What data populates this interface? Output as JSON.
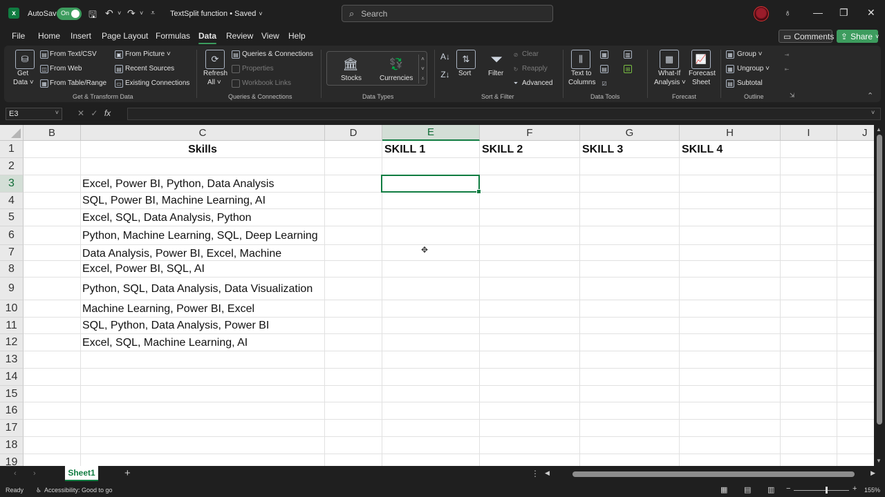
{
  "titlebar": {
    "autosave_label": "AutoSave",
    "autosave_state": "On",
    "file_title": "TextSplit function • Saved",
    "search_placeholder": "Search"
  },
  "menu": {
    "tabs": [
      "File",
      "Home",
      "Insert",
      "Page Layout",
      "Formulas",
      "Data",
      "Review",
      "View",
      "Help"
    ],
    "active": "Data",
    "comments_label": "Comments",
    "share_label": "Share"
  },
  "ribbon": {
    "get_transform": {
      "get_data": [
        "Get",
        "Data ˅"
      ],
      "from_text_csv": "From Text/CSV",
      "from_web": "From Web",
      "from_table_range": "From Table/Range",
      "from_picture": "From Picture ˅",
      "recent_sources": "Recent Sources",
      "existing_connections": "Existing Connections",
      "group_label": "Get & Transform Data"
    },
    "queries": {
      "refresh_all": [
        "Refresh",
        "All ˅"
      ],
      "queries_connections": "Queries & Connections",
      "properties": "Properties",
      "workbook_links": "Workbook Links",
      "group_label": "Queries & Connections"
    },
    "data_types": {
      "stocks": "Stocks",
      "currencies": "Currencies",
      "group_label": "Data Types"
    },
    "sort_filter": {
      "sort": "Sort",
      "filter": "Filter",
      "clear": "Clear",
      "reapply": "Reapply",
      "advanced": "Advanced",
      "group_label": "Sort & Filter"
    },
    "data_tools": {
      "text_to_columns": [
        "Text to",
        "Columns"
      ],
      "group_label": "Data Tools"
    },
    "forecast": {
      "what_if": [
        "What-If",
        "Analysis ˅"
      ],
      "forecast_sheet": [
        "Forecast",
        "Sheet"
      ],
      "group_label": "Forecast"
    },
    "outline": {
      "group": "Group ˅",
      "ungroup": "Ungroup ˅",
      "subtotal": "Subtotal",
      "group_label": "Outline"
    }
  },
  "formula_bar": {
    "name_box": "E3",
    "formula": ""
  },
  "sheet": {
    "columns": [
      "B",
      "C",
      "D",
      "E",
      "F",
      "G",
      "H",
      "I",
      "J"
    ],
    "selected_column": "E",
    "rows": [
      "1",
      "2",
      "3",
      "4",
      "5",
      "6",
      "7",
      "8",
      "9",
      "10",
      "11",
      "12",
      "13",
      "14",
      "15",
      "16",
      "17",
      "18",
      "19"
    ],
    "selected_row": "3",
    "headers": {
      "skills": "Skills",
      "skill1": "SKILL 1",
      "skill2": "SKILL 2",
      "skill3": "SKILL 3",
      "skill4": "SKILL 4"
    },
    "skills_values": [
      "Excel, Power BI, Python, Data Analysis",
      "SQL, Power BI, Machine Learning, AI",
      "Excel, SQL, Data Analysis, Python",
      "Python, Machine Learning, SQL, Deep Learning",
      "Data Analysis, Power BI, Excel, Machine",
      "Excel, Power BI, SQL, AI",
      "Python, SQL, Data Analysis, Data Visualization",
      "Machine Learning, Power BI, Excel",
      "SQL, Python, Data Analysis, Power BI",
      "Excel, SQL, Machine Learning, AI"
    ]
  },
  "sheet_tabs": {
    "active_sheet": "Sheet1",
    "add_symbol": "+"
  },
  "status": {
    "mode": "Ready",
    "accessibility": "Accessibility: Good to go",
    "zoom": "155%"
  }
}
